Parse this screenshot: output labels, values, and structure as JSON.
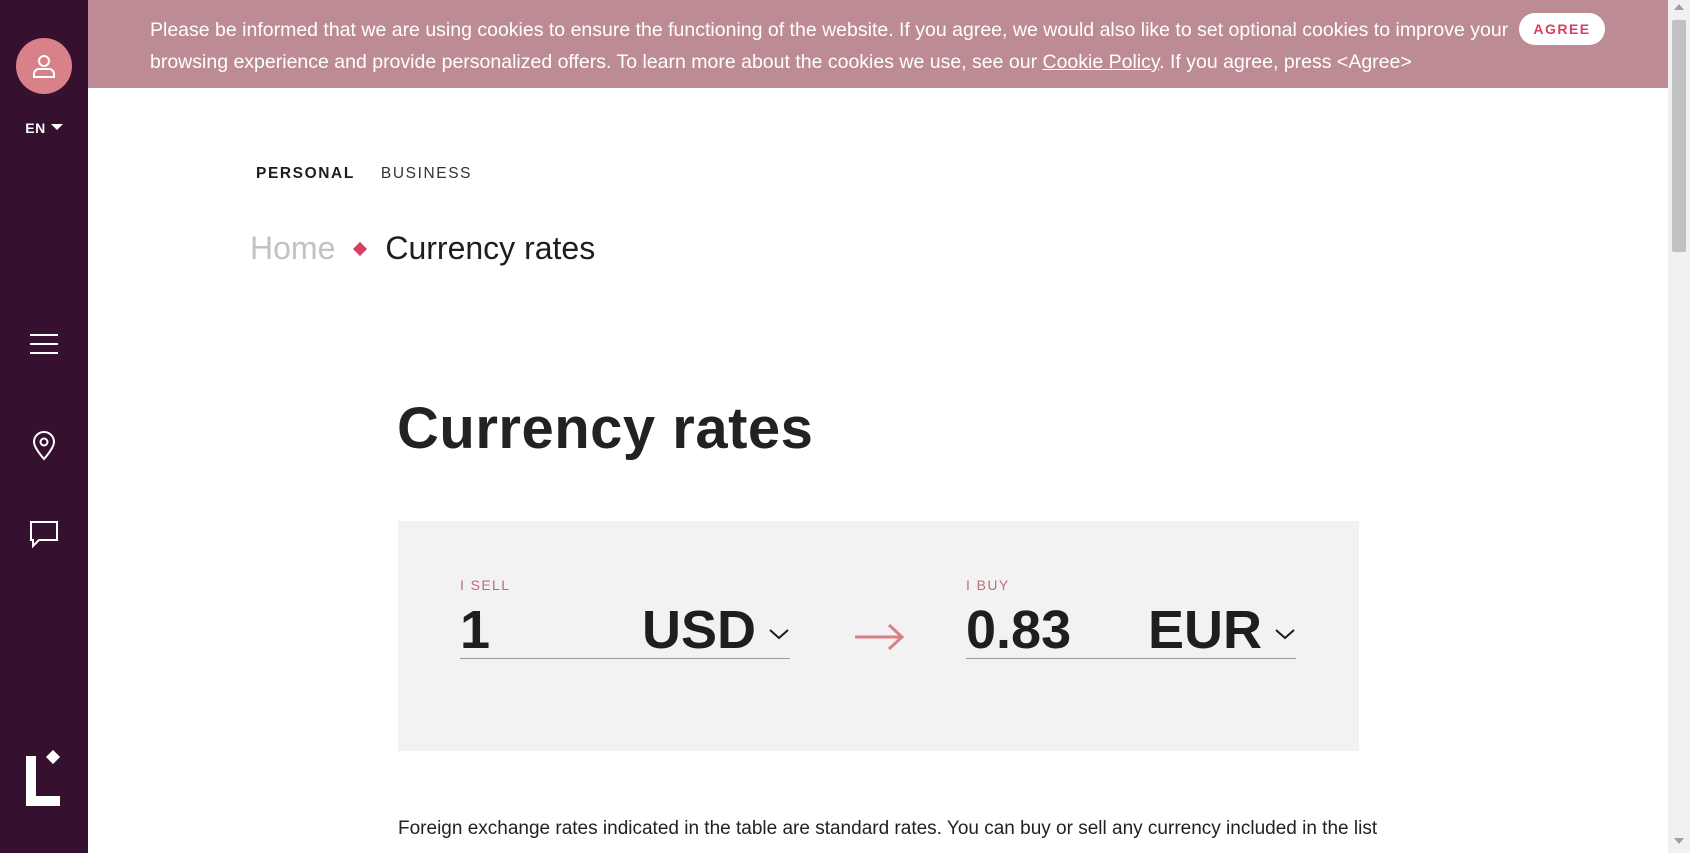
{
  "sidebar": {
    "language": "EN",
    "icons": [
      "user-icon",
      "menu-icon",
      "location-pin-icon",
      "chat-icon",
      "logo"
    ]
  },
  "cookie_banner": {
    "text_before_link": "Please be informed that we are using cookies to ensure the functioning of the website. If you agree, we would also like to set optional cookies to improve your browsing experience and provide personalized offers. To learn more about the cookies we use, see our ",
    "link_text": "Cookie Policy",
    "text_after_link": ". If you agree, press <Agree>",
    "agree_label": "AGREE"
  },
  "segments": {
    "personal": "PERSONAL",
    "business": "BUSINESS"
  },
  "breadcrumb": {
    "home": "Home",
    "current": "Currency rates"
  },
  "page_title": "Currency rates",
  "converter": {
    "sell": {
      "label": "I SELL",
      "amount": "1",
      "currency": "USD"
    },
    "buy": {
      "label": "I BUY",
      "amount": "0.83",
      "currency": "EUR"
    }
  },
  "description": "Foreign exchange rates indicated in the table are standard rates. You can buy or sell any currency included in the list",
  "colors": {
    "sidebar": "#35102f",
    "cookie_banner": "#bd8b93",
    "accent": "#d63e64",
    "avatar": "#d98188",
    "converter_bg": "#f2f2f2"
  }
}
